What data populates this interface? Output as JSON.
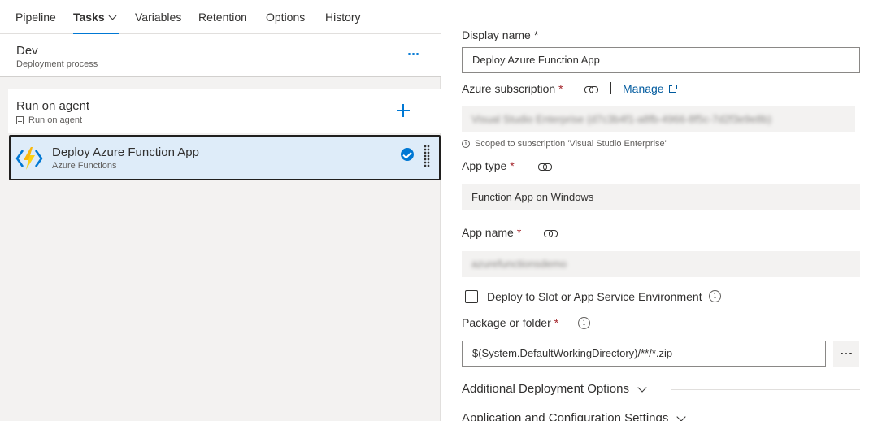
{
  "nav": {
    "tabs": [
      {
        "label": "Pipeline"
      },
      {
        "label": "Tasks"
      },
      {
        "label": "Variables"
      },
      {
        "label": "Retention"
      },
      {
        "label": "Options"
      },
      {
        "label": "History"
      }
    ],
    "active_tab": "Tasks",
    "accent_color": "#0078d4"
  },
  "stage": {
    "title": "Dev",
    "subtitle": "Deployment process"
  },
  "agent_job": {
    "title": "Run on agent",
    "subtitle": "Run on agent"
  },
  "task": {
    "title": "Deploy Azure Function App",
    "subtitle": "Azure Functions",
    "icon": "azure-functions-icon",
    "enabled": true
  },
  "form": {
    "display_name": {
      "label": "Display name",
      "required_mark": "*",
      "value": "Deploy Azure Function App"
    },
    "azure_subscription": {
      "label": "Azure subscription",
      "required_mark": "*",
      "manage_label": "Manage",
      "value": "Visual Studio Enterprise (d7c3b4f1-a8fb-4966-8f5c-7d2f3e9e8b)",
      "scope_note": "Scoped to subscription 'Visual Studio Enterprise'"
    },
    "app_type": {
      "label": "App type",
      "required_mark": "*",
      "value": "Function App on Windows"
    },
    "app_name": {
      "label": "App name",
      "required_mark": "*",
      "value": "azurefunctionsdemo"
    },
    "deploy_to_slot": {
      "label": "Deploy to Slot or App Service Environment",
      "checked": false
    },
    "package": {
      "label": "Package or folder",
      "required_mark": "*",
      "value": "$(System.DefaultWorkingDirectory)/**/*.zip"
    },
    "sections": [
      {
        "label": "Additional Deployment Options"
      },
      {
        "label": "Application and Configuration Settings"
      }
    ]
  }
}
